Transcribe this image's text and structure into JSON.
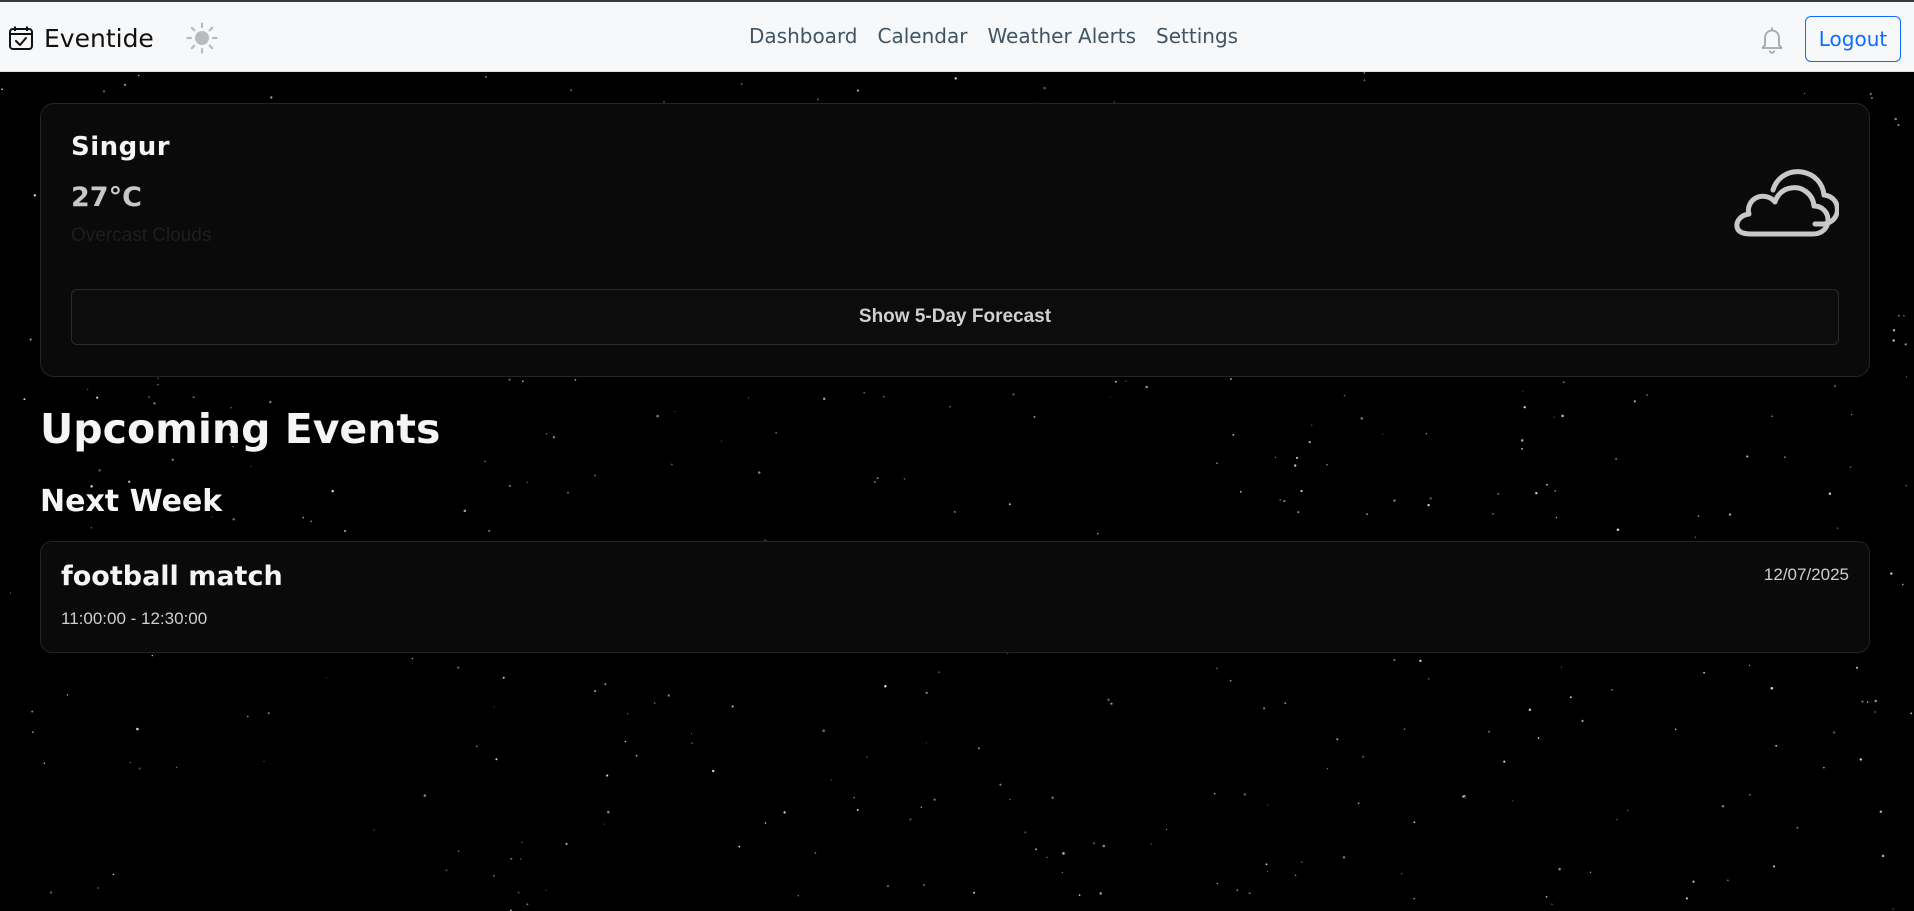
{
  "navbar": {
    "brand": "Eventide",
    "links": [
      "Dashboard",
      "Calendar",
      "Weather Alerts",
      "Settings"
    ],
    "logout_label": "Logout",
    "icons": {
      "brand": "calendar-check-icon",
      "theme_toggle": "sun-icon",
      "notifications": "bell-icon"
    }
  },
  "weather": {
    "city": "Singur",
    "temperature": "27°C",
    "condition": "Overcast Clouds",
    "icon": "cloud-icon",
    "forecast_button_label": "Show 5-Day Forecast"
  },
  "events": {
    "heading": "Upcoming Events",
    "groups": [
      {
        "label": "Next Week",
        "items": [
          {
            "title": "football match",
            "time": "11:00:00 - 12:30:00",
            "date": "12/07/2025"
          }
        ]
      }
    ]
  },
  "colors": {
    "page_background": "#000000",
    "navbar_background": "#f7f8f9",
    "accent": "#0d6efd",
    "card_background": "#0a0a0a",
    "card_border": "#242424"
  }
}
